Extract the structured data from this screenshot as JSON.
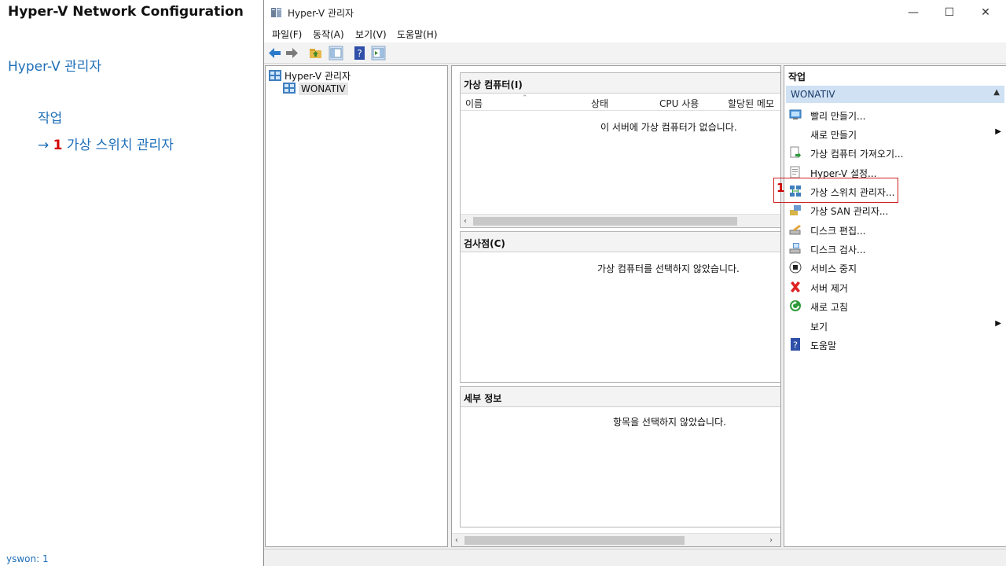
{
  "guide": {
    "title": "Hyper-V Network Configuration",
    "subtitle": "Hyper-V 관리자",
    "step_heading": "작업",
    "step_arrow": "→",
    "step_number": "1",
    "step_label": "가상 스위치 관리자",
    "footer": "yswon:   1"
  },
  "window": {
    "title": "Hyper-V 관리자",
    "minimize": "—",
    "maximize": "☐",
    "close": "✕"
  },
  "menu": [
    "파일(F)",
    "동작(A)",
    "보기(V)",
    "도움말(H)"
  ],
  "tree": {
    "root": "Hyper-V 관리자",
    "server": "WONATIV"
  },
  "vm_pane": {
    "header": "가상 컴퓨터(I)",
    "columns": [
      "이름",
      "상태",
      "CPU 사용",
      "할당된 메모"
    ],
    "empty": "이 서버에 가상 컴퓨터가 없습니다."
  },
  "checkpoint_pane": {
    "header": "검사점(C)",
    "empty": "가상 컴퓨터를 선택하지 않았습니다."
  },
  "details_pane": {
    "header": "세부 정보",
    "empty": "항목을 선택하지 않았습니다."
  },
  "actions": {
    "header": "작업",
    "group": "WONATIV",
    "items": [
      {
        "label": "빨리 만들기...",
        "icon": "quick-create-icon"
      },
      {
        "label": "새로 만들기",
        "icon": "none",
        "submenu": "▶"
      },
      {
        "label": "가상 컴퓨터 가져오기...",
        "icon": "import-vm-icon"
      },
      {
        "label": "Hyper-V 설정...",
        "icon": "settings-icon"
      },
      {
        "label": "가상 스위치 관리자...",
        "icon": "virtual-switch-icon"
      },
      {
        "label": "가상 SAN 관리자...",
        "icon": "san-icon"
      },
      {
        "label": "디스크 편집...",
        "icon": "edit-disk-icon"
      },
      {
        "label": "디스크 검사...",
        "icon": "inspect-disk-icon"
      },
      {
        "label": "서비스 중지",
        "icon": "stop-service-icon"
      },
      {
        "label": "서버 제거",
        "icon": "remove-server-icon"
      },
      {
        "label": "새로 고침",
        "icon": "refresh-icon"
      },
      {
        "label": "보기",
        "icon": "none",
        "submenu": "▶"
      },
      {
        "label": "도움말",
        "icon": "help-icon"
      }
    ],
    "highlight_number": "1"
  },
  "colors": {
    "accent_blue": "#1e6fb8",
    "highlight_red": "#cc2222",
    "group_bg": "#cfe1f3"
  }
}
